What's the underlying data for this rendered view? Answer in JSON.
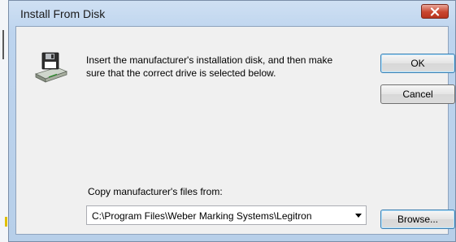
{
  "dialog": {
    "title": "Install From Disk",
    "message": "Insert the manufacturer's installation disk, and then make sure that the correct drive is selected below.",
    "icon": "floppy-disk-drive-icon"
  },
  "buttons": {
    "ok_label": "OK",
    "cancel_label": "Cancel",
    "browse_label": "Browse..."
  },
  "copy_from": {
    "label": "Copy manufacturer's files from:",
    "value": "C:\\Program Files\\Weber Marking Systems\\Legitron"
  },
  "colors": {
    "title_bar": "#bdd4ee",
    "close_button": "#c9462f",
    "client_bg": "#f0f0f0",
    "focus_border": "#3c7fb1"
  }
}
